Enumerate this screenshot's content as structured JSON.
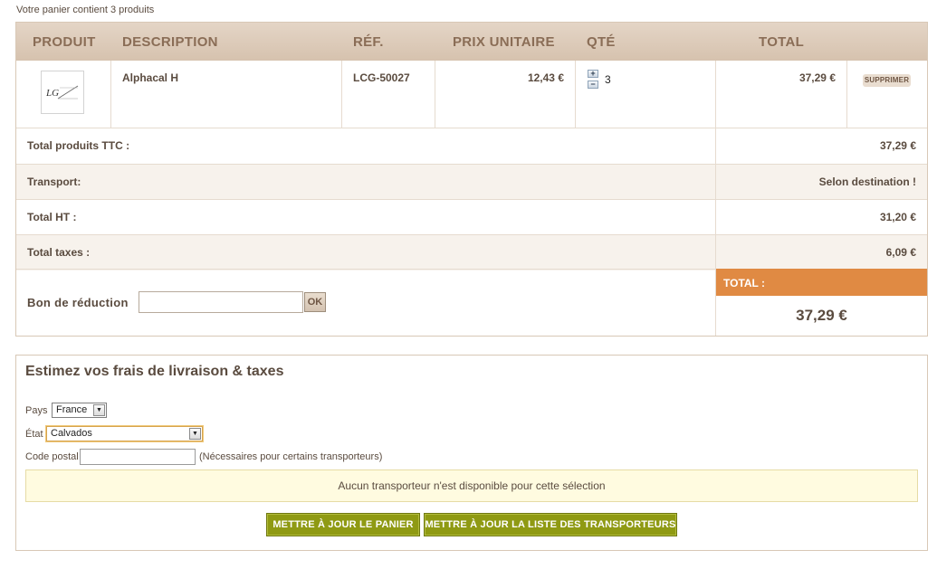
{
  "cart": {
    "summary": "Votre panier contient 3 produits",
    "headers": {
      "product": "PRODUIT",
      "description": "DESCRIPTION",
      "ref": "RÉF.",
      "unit_price": "PRIX UNITAIRE",
      "qty": "QTÉ",
      "total": "TOTAL"
    },
    "items": [
      {
        "name": "Alphacal H",
        "ref": "LCG-50027",
        "unit_price": "12,43 €",
        "qty": "3",
        "total": "37,29 €",
        "delete_label": "SUPPRIMER",
        "thumb_text": "LCG",
        "qty_plus": "+",
        "qty_minus": "−"
      }
    ],
    "totals": [
      {
        "label": "Total produits TTC :",
        "value": "37,29 €"
      },
      {
        "label": "Transport:",
        "value": "Selon destination !"
      },
      {
        "label": "Total HT :",
        "value": "31,20 €"
      },
      {
        "label": "Total taxes :",
        "value": "6,09 €"
      }
    ],
    "voucher": {
      "label": "Bon de réduction",
      "value": "",
      "ok_label": "OK"
    },
    "grand_total": {
      "label": "TOTAL :",
      "value": "37,29 €"
    }
  },
  "estimate": {
    "title": "Estimez vos frais de livraison & taxes",
    "country": {
      "label": "Pays",
      "selected": "France"
    },
    "state": {
      "label": "État",
      "selected": "Calvados"
    },
    "postcode": {
      "label": "Code postal",
      "value": "",
      "hint": "(Nécessaires pour certains transporteurs)"
    },
    "notice": "Aucun transporteur n'est disponible pour cette sélection",
    "buttons": {
      "update_cart": "METTRE À JOUR LE PANIER",
      "update_carriers": "METTRE À JOUR LA LISTE DES TRANSPORTEURS"
    }
  },
  "colors": {
    "header_bg": "#d6c2ae",
    "total_accent": "#e08a43",
    "button_green": "#8f9a13",
    "notice_bg": "#fffbe0"
  }
}
